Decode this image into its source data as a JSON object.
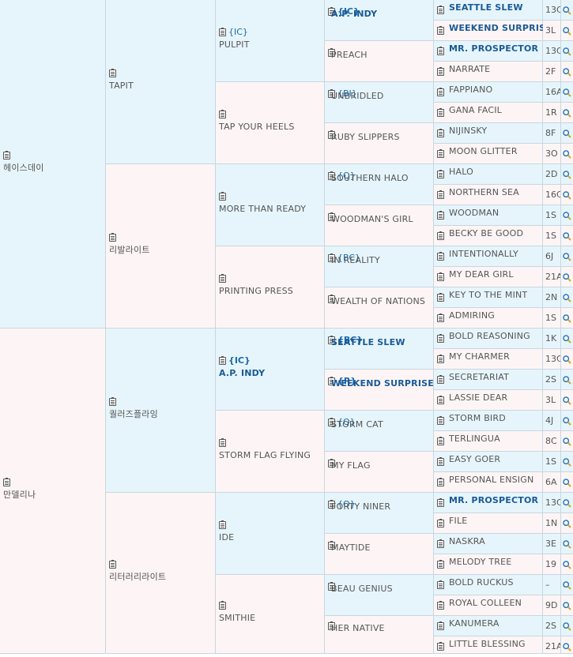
{
  "gen1": [
    {
      "name": "헤이스데이"
    },
    {
      "name": "만델리나"
    }
  ],
  "gen2": [
    {
      "name": "TAPIT"
    },
    {
      "name": "리발라이트"
    },
    {
      "name": "퀄러즈플라잉"
    },
    {
      "name": "리터러리라이트"
    }
  ],
  "gen3": [
    {
      "tag": "{IC}",
      "name": "PULPIT",
      "bold": false
    },
    {
      "tag": "",
      "name": "TAP YOUR HEELS",
      "bold": false
    },
    {
      "tag": "",
      "name": "MORE THAN READY",
      "bold": false
    },
    {
      "tag": "",
      "name": "PRINTING PRESS",
      "bold": false
    },
    {
      "tag": "{IC}",
      "name": "A.P. INDY",
      "bold": true
    },
    {
      "tag": "",
      "name": "STORM FLAG FLYING",
      "bold": false
    },
    {
      "tag": "",
      "name": "IDE",
      "bold": false
    },
    {
      "tag": "",
      "name": "SMITHIE",
      "bold": false
    }
  ],
  "gen4": [
    {
      "tag": "{IC}",
      "name": "A.P. INDY",
      "bold": true
    },
    {
      "tag": "",
      "name": "PREACH",
      "bold": false
    },
    {
      "tag": "{BI}",
      "name": "UNBRIDLED",
      "bold": false
    },
    {
      "tag": "",
      "name": "RUBY SLIPPERS",
      "bold": false
    },
    {
      "tag": "{Q}",
      "name": "SOUTHERN HALO",
      "bold": false
    },
    {
      "tag": "",
      "name": "WOODMAN'S GIRL",
      "bold": false
    },
    {
      "tag": "{BC}",
      "name": "IN REALITY",
      "bold": false
    },
    {
      "tag": "",
      "name": "WEALTH OF NATIONS",
      "bold": false
    },
    {
      "tag": "{BC}",
      "name": "SEATTLE SLEW",
      "bold": true
    },
    {
      "tag": "{R}",
      "name": "WEEKEND SURPRISE",
      "bold": true
    },
    {
      "tag": "{Q}",
      "name": "STORM CAT",
      "bold": false
    },
    {
      "tag": "",
      "name": "MY FLAG",
      "bold": false
    },
    {
      "tag": "{Q}",
      "name": "FORTY NINER",
      "bold": false
    },
    {
      "tag": "",
      "name": "MAYTIDE",
      "bold": false
    },
    {
      "tag": "",
      "name": "BEAU GENIUS",
      "bold": false
    },
    {
      "tag": "",
      "name": "HER NATIVE",
      "bold": false
    }
  ],
  "gen5": [
    {
      "name": "SEATTLE SLEW",
      "bold": true,
      "code": "13C"
    },
    {
      "name": "WEEKEND SURPRISE",
      "bold": true,
      "code": "3L"
    },
    {
      "name": "MR. PROSPECTOR",
      "bold": true,
      "code": "13C"
    },
    {
      "name": "NARRATE",
      "bold": false,
      "code": "2F"
    },
    {
      "name": "FAPPIANO",
      "bold": false,
      "code": "16A"
    },
    {
      "name": "GANA FACIL",
      "bold": false,
      "code": "1R"
    },
    {
      "name": "NIJINSKY",
      "bold": false,
      "code": "8F"
    },
    {
      "name": "MOON GLITTER",
      "bold": false,
      "code": "3O"
    },
    {
      "name": "HALO",
      "bold": false,
      "code": "2D"
    },
    {
      "name": "NORTHERN SEA",
      "bold": false,
      "code": "16C"
    },
    {
      "name": "WOODMAN",
      "bold": false,
      "code": "1S"
    },
    {
      "name": "BECKY BE GOOD",
      "bold": false,
      "code": "1S"
    },
    {
      "name": "INTENTIONALLY",
      "bold": false,
      "code": "6J"
    },
    {
      "name": "MY DEAR GIRL",
      "bold": false,
      "code": "21A"
    },
    {
      "name": "KEY TO THE MINT",
      "bold": false,
      "code": "2N"
    },
    {
      "name": "ADMIRING",
      "bold": false,
      "code": "1S"
    },
    {
      "name": "BOLD REASONING",
      "bold": false,
      "code": "1K"
    },
    {
      "name": "MY CHARMER",
      "bold": false,
      "code": "13C"
    },
    {
      "name": "SECRETARIAT",
      "bold": false,
      "code": "2S"
    },
    {
      "name": "LASSIE DEAR",
      "bold": false,
      "code": "3L"
    },
    {
      "name": "STORM BIRD",
      "bold": false,
      "code": "4J"
    },
    {
      "name": "TERLINGUA",
      "bold": false,
      "code": "8C"
    },
    {
      "name": "EASY GOER",
      "bold": false,
      "code": "1S"
    },
    {
      "name": "PERSONAL ENSIGN",
      "bold": false,
      "code": "6A"
    },
    {
      "name": "MR. PROSPECTOR",
      "bold": true,
      "code": "13C"
    },
    {
      "name": "FILE",
      "bold": false,
      "code": "1N"
    },
    {
      "name": "NASKRA",
      "bold": false,
      "code": "3E"
    },
    {
      "name": "MELODY TREE",
      "bold": false,
      "code": "19"
    },
    {
      "name": "BOLD RUCKUS",
      "bold": false,
      "code": "–"
    },
    {
      "name": "ROYAL COLLEEN",
      "bold": false,
      "code": "9D"
    },
    {
      "name": "KANUMERA",
      "bold": false,
      "code": "2S"
    },
    {
      "name": "LITTLE BLESSING",
      "bold": false,
      "code": "21A"
    }
  ],
  "colors": {
    "sire_bg": "#e6f5fb",
    "dam_bg": "#fdf5f5",
    "link_blue": "#1a5a96",
    "tag_blue": "#1a6aa8",
    "border": "#c9d6de"
  },
  "icons": {
    "note": "clipboard-icon",
    "search": "magnifier-icon"
  }
}
